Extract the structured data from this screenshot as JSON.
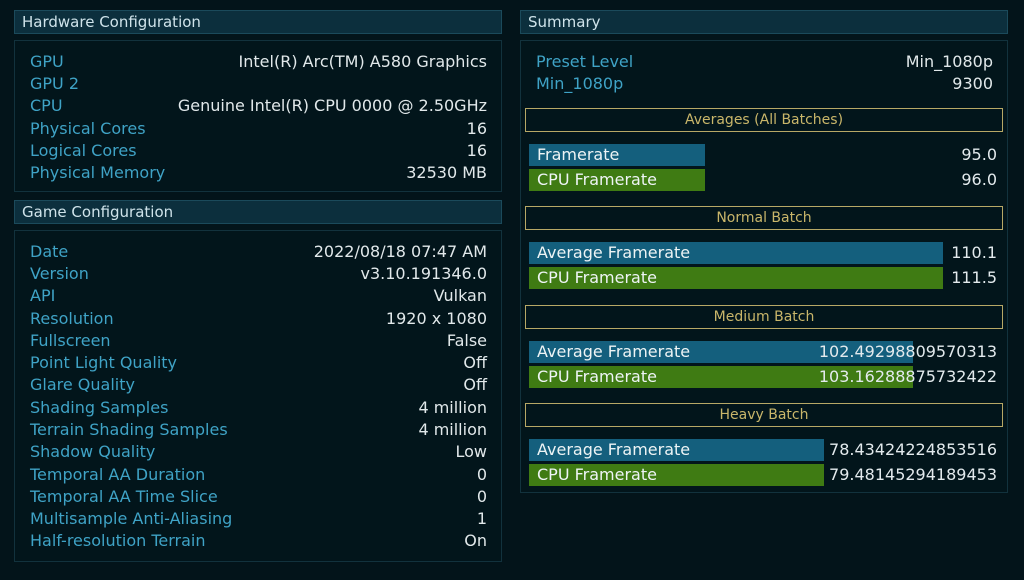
{
  "hardware": {
    "header": "Hardware Configuration",
    "rows": [
      {
        "key": "GPU",
        "value": "Intel(R) Arc(TM) A580 Graphics"
      },
      {
        "key": "GPU 2",
        "value": ""
      },
      {
        "key": "CPU",
        "value": "Genuine Intel(R) CPU 0000 @ 2.50GHz"
      },
      {
        "key": "Physical Cores",
        "value": "16"
      },
      {
        "key": "Logical Cores",
        "value": "16"
      },
      {
        "key": "Physical Memory",
        "value": "32530 MB"
      }
    ]
  },
  "game": {
    "header": "Game Configuration",
    "rows": [
      {
        "key": "Date",
        "value": "2022/08/18 07:47 AM"
      },
      {
        "key": "Version",
        "value": "v3.10.191346.0"
      },
      {
        "key": "API",
        "value": "Vulkan"
      },
      {
        "key": "Resolution",
        "value": "1920 x 1080"
      },
      {
        "key": "Fullscreen",
        "value": "False"
      },
      {
        "key": "Point Light Quality",
        "value": "Off"
      },
      {
        "key": "Glare Quality",
        "value": "Off"
      },
      {
        "key": "Shading Samples",
        "value": "4 million"
      },
      {
        "key": "Terrain Shading Samples",
        "value": "4 million"
      },
      {
        "key": "Shadow Quality",
        "value": "Low"
      },
      {
        "key": "Temporal AA Duration",
        "value": "0"
      },
      {
        "key": "Temporal AA Time Slice",
        "value": "0"
      },
      {
        "key": "Multisample Anti-Aliasing",
        "value": "1"
      },
      {
        "key": "Half-resolution Terrain",
        "value": "On"
      }
    ]
  },
  "summary": {
    "header": "Summary",
    "rows": [
      {
        "key": "Preset Level",
        "value": "Min_1080p"
      },
      {
        "key": "Min_1080p",
        "value": "9300"
      }
    ],
    "batches": [
      {
        "title": "Averages (All Batches)",
        "bars": [
          {
            "label": "Framerate",
            "value": "95.0",
            "fill": 0.376,
            "color": "blue"
          },
          {
            "label": "CPU Framerate",
            "value": "96.0",
            "fill": 0.376,
            "color": "green"
          }
        ]
      },
      {
        "title": "Normal Batch",
        "bars": [
          {
            "label": "Average Framerate",
            "value": "110.1",
            "fill": 0.885,
            "color": "blue"
          },
          {
            "label": "CPU Framerate",
            "value": "111.5",
            "fill": 0.885,
            "color": "green"
          }
        ]
      },
      {
        "title": "Medium Batch",
        "bars": [
          {
            "label": "Average Framerate",
            "value": "102.49298809570313",
            "fill": 0.82,
            "color": "blue"
          },
          {
            "label": "CPU Framerate",
            "value": "103.16288875732422",
            "fill": 0.82,
            "color": "green"
          }
        ]
      },
      {
        "title": "Heavy Batch",
        "bars": [
          {
            "label": "Average Framerate",
            "value": "78.43424224853516",
            "fill": 0.63,
            "color": "blue"
          },
          {
            "label": "CPU Framerate",
            "value": "79.48145294189453",
            "fill": 0.63,
            "color": "green"
          }
        ]
      }
    ]
  }
}
